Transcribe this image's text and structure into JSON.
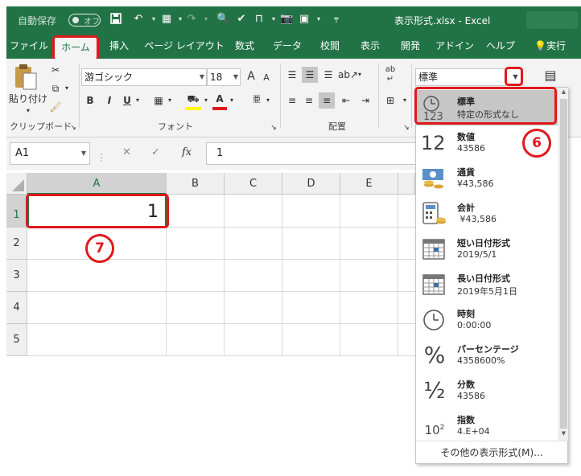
{
  "titlebar": {
    "autosave_label": "自動保存",
    "autosave_state": "オフ",
    "title": "表示形式.xlsx - Excel"
  },
  "tabs": [
    "ファイル",
    "ホーム",
    "挿入",
    "ページ レイアウト",
    "数式",
    "データ",
    "校閲",
    "表示",
    "開発",
    "アドイン",
    "ヘルプ",
    "実行"
  ],
  "active_tab": "ホーム",
  "ribbon": {
    "clipboard": {
      "paste_label": "貼り付け",
      "group_label": "クリップボード"
    },
    "font": {
      "font_name": "游ゴシック",
      "font_size": "18",
      "group_label": "フォント",
      "bold": "B",
      "italic": "I",
      "underline": "U",
      "grow": "A",
      "shrink": "A"
    },
    "alignment": {
      "group_label": "配置"
    },
    "number": {
      "format_value": "標準"
    },
    "wrap_label": "ab"
  },
  "formula_bar": {
    "name_box": "A1",
    "fx_label": "fx",
    "formula": "1"
  },
  "grid": {
    "columns": [
      "A",
      "B",
      "C",
      "D",
      "E"
    ],
    "rows": [
      "1",
      "2",
      "3",
      "4",
      "5"
    ],
    "cell_a1": "1"
  },
  "dropdown": {
    "items": [
      {
        "name": "標準",
        "example": "特定の形式なし",
        "icon": "clock-123-icon"
      },
      {
        "name": "数値",
        "example": "43586",
        "icon": "number-12-icon"
      },
      {
        "name": "通貨",
        "example": "¥43,586",
        "icon": "currency-icon"
      },
      {
        "name": "会計",
        "example": " ¥43,586",
        "icon": "accounting-icon"
      },
      {
        "name": "短い日付形式",
        "example": "2019/5/1",
        "icon": "calendar-icon"
      },
      {
        "name": "長い日付形式",
        "example": "2019年5月1日",
        "icon": "calendar-icon"
      },
      {
        "name": "時刻",
        "example": "0:00:00",
        "icon": "clock-icon"
      },
      {
        "name": "パーセンテージ",
        "example": "4358600%",
        "icon": "percent-icon"
      },
      {
        "name": "分数",
        "example": "43586",
        "icon": "fraction-icon"
      },
      {
        "name": "指数",
        "example": "4.E+04",
        "icon": "exponent-icon"
      }
    ],
    "icon_texts": {
      "twelve": "12",
      "one_two_three": "123",
      "percent": "%",
      "half": "½",
      "ten": "10",
      "sq": "2"
    },
    "more_label": "その他の表示形式(M)...",
    "selected_index": 0
  },
  "callouts": {
    "six": "6",
    "seven": "7"
  },
  "colors": {
    "excel_green": "#217346",
    "callout_red": "#e0191b",
    "ribbon_bg": "#f3f3f3"
  }
}
